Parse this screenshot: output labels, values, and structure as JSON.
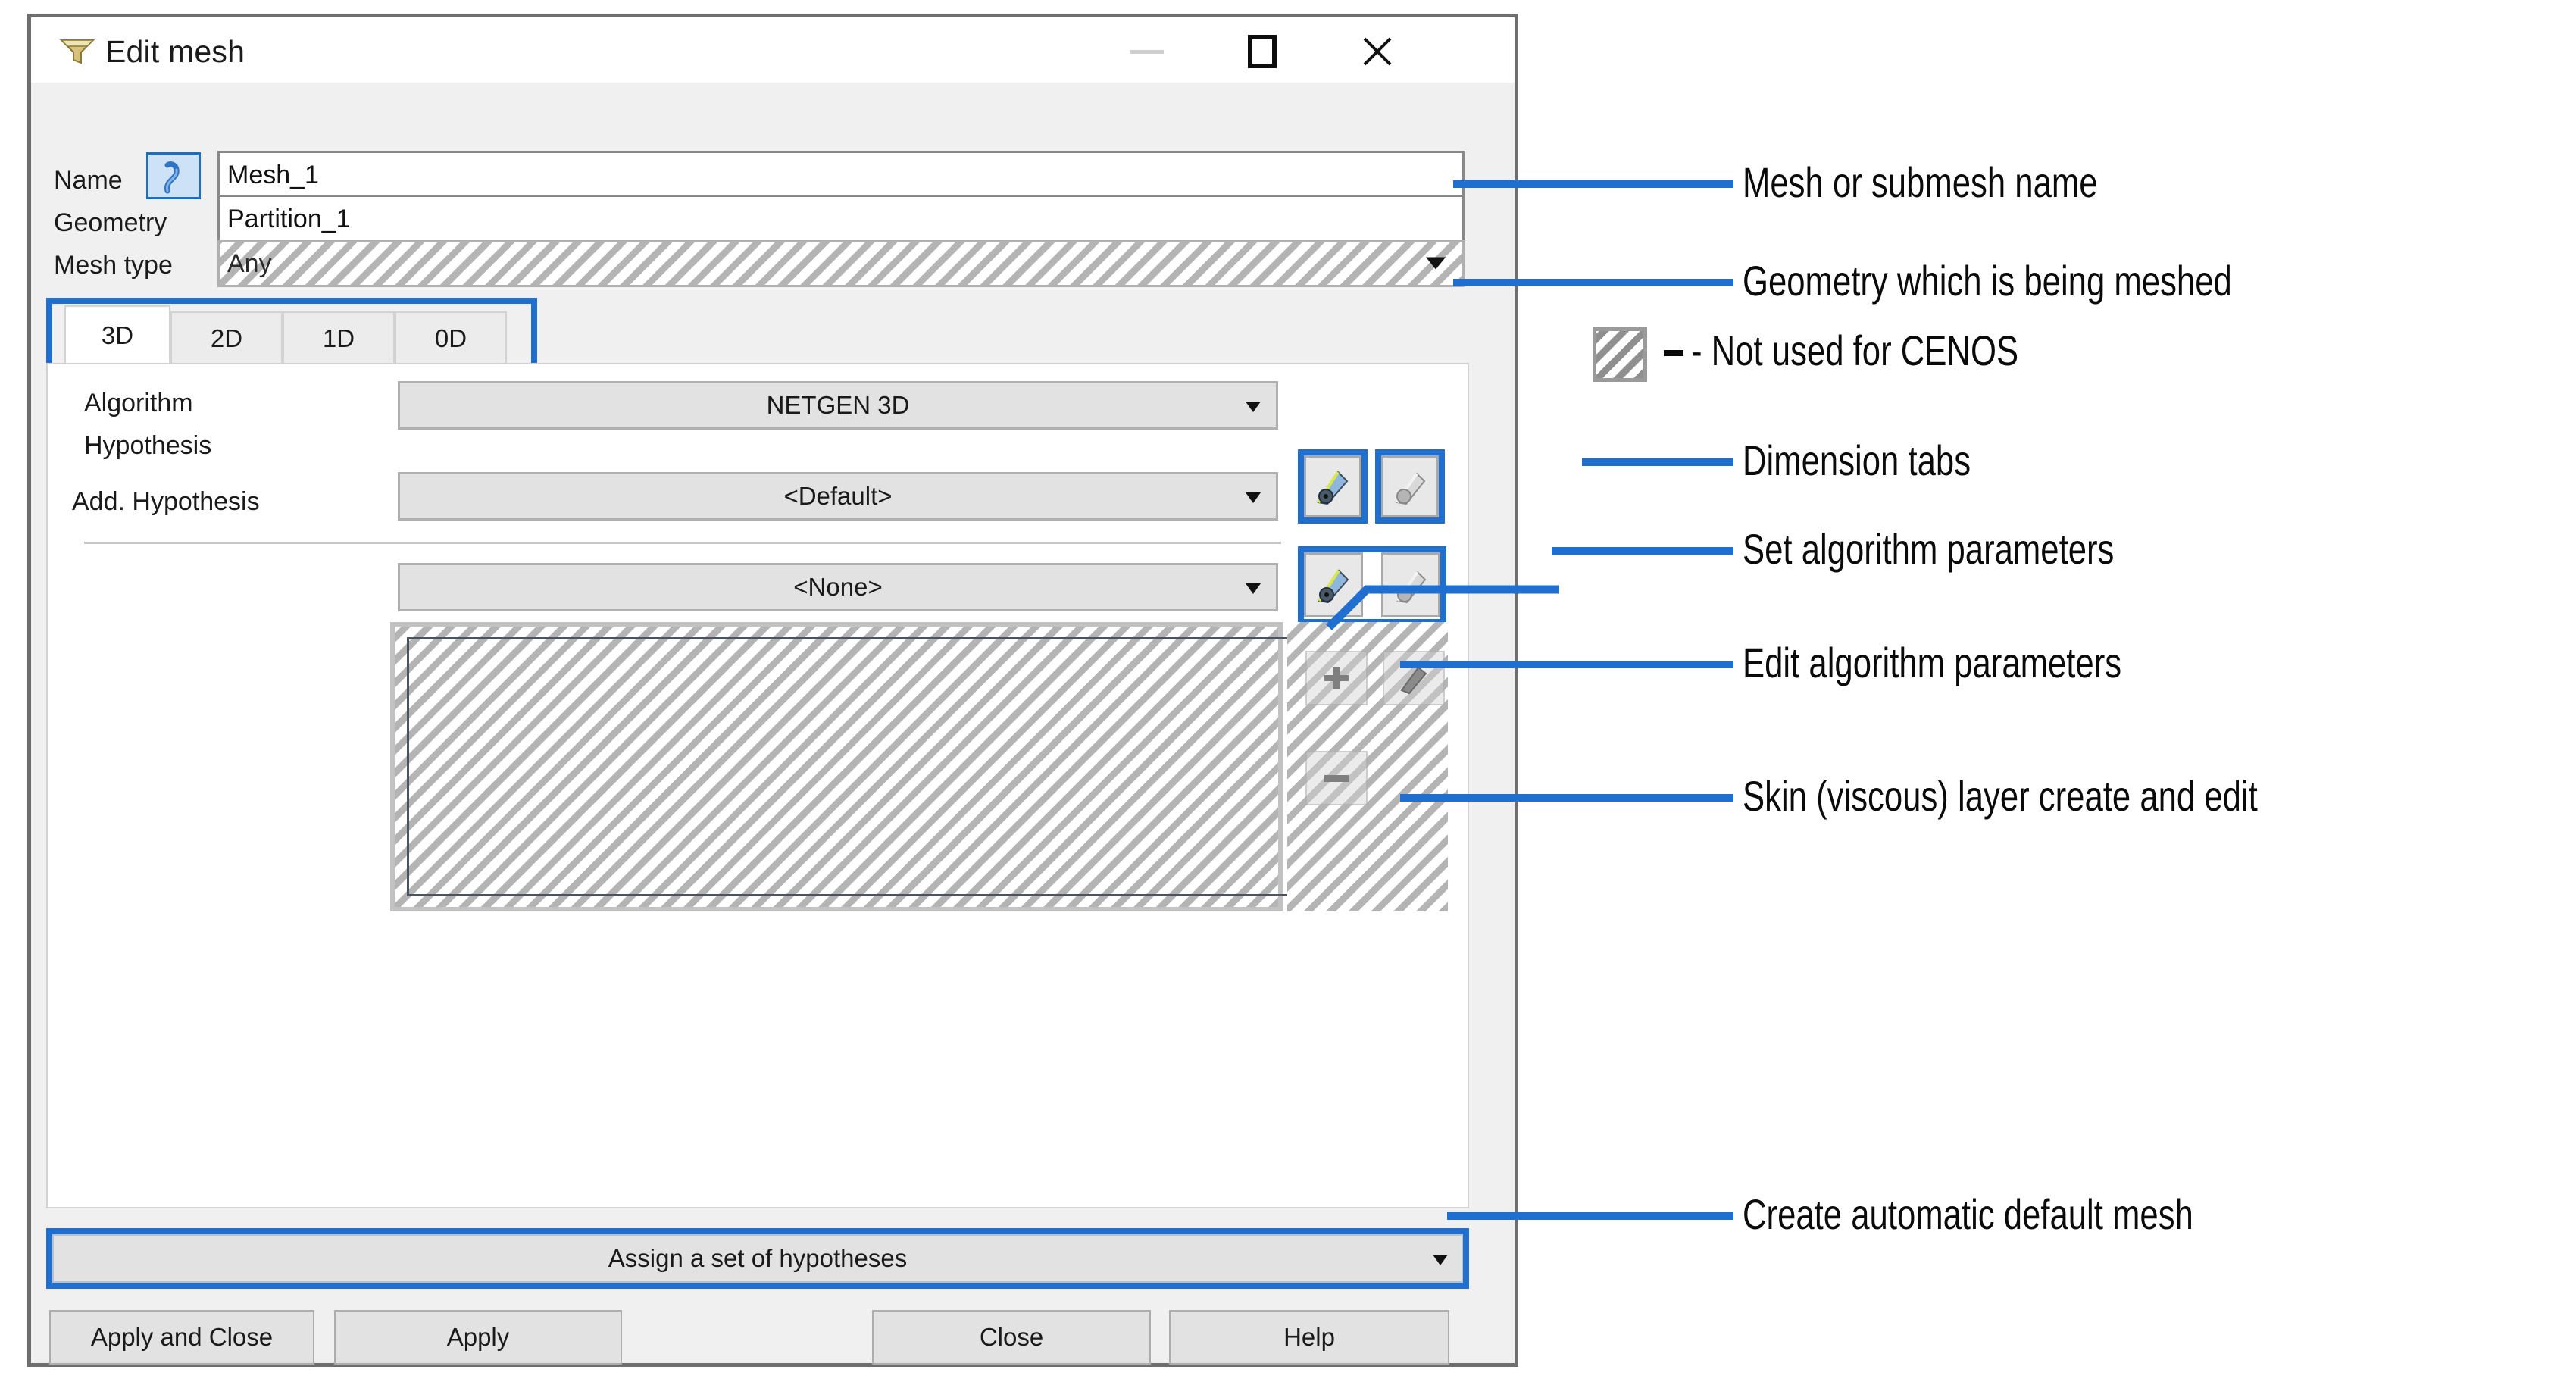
{
  "window": {
    "title": "Edit mesh",
    "icon": "mesh-funnel-icon",
    "minimize_label": "Minimize",
    "maximize_label": "Maximize",
    "close_label": "Close"
  },
  "form": {
    "name_label": "Name",
    "name_value": "Mesh_1",
    "name_icon": "mesh-select-icon",
    "geometry_label": "Geometry",
    "geometry_value": "Partition_1",
    "mesh_type_label": "Mesh type",
    "mesh_type_value": "Any"
  },
  "tabs": [
    {
      "label": "3D",
      "active": true
    },
    {
      "label": "2D",
      "active": false
    },
    {
      "label": "1D",
      "active": false
    },
    {
      "label": "0D",
      "active": false
    }
  ],
  "panel": {
    "algorithm_label": "Algorithm",
    "algorithm_value": "NETGEN 3D",
    "hypothesis_label": "Hypothesis",
    "hypothesis_value": "<Default>",
    "add_hypothesis_label": "Add. Hypothesis",
    "add_hypothesis_value": "<None>",
    "set_params_icon": "gear-plus-icon",
    "edit_params_icon": "gear-edit-icon",
    "skin_create_icon": "gear-plus-icon",
    "skin_edit_icon": "gear-edit-icon",
    "list_add_icon": "plus-icon",
    "list_edit_icon": "edit-icon",
    "list_remove_icon": "minus-icon"
  },
  "assign": {
    "label": "Assign a set of hypotheses"
  },
  "buttons": {
    "apply_and_close": "Apply and Close",
    "apply": "Apply",
    "close": "Close",
    "help": "Help"
  },
  "annotations": [
    {
      "text": "Mesh or submesh name"
    },
    {
      "text": "Geometry which is being meshed"
    },
    {
      "text": "- Not used for CENOS"
    },
    {
      "text": "Dimension tabs"
    },
    {
      "text": "Set algorithm parameters"
    },
    {
      "text": "Edit algorithm parameters"
    },
    {
      "text": "Skin (viscous) layer create and edit"
    },
    {
      "text": "Create automatic default mesh"
    }
  ],
  "colors": {
    "accent": "#1f6fd0",
    "dialog_bg": "#f0f0f0",
    "field_border": "#888888",
    "disabled_fill": "#e2e2e2",
    "hatch": "#b4b4b4"
  }
}
